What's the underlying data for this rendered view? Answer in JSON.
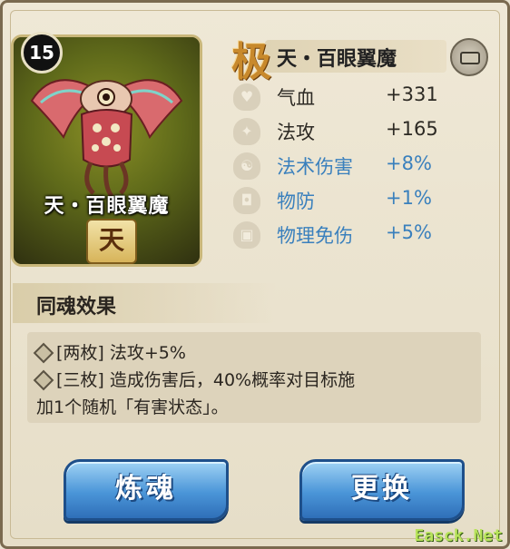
{
  "card": {
    "level": "15",
    "name": "天・百眼翼魔",
    "grade": "天"
  },
  "header": {
    "rank_char": "极",
    "title": "天・百眼翼魔",
    "lock_icon": "lock-icon"
  },
  "stats": [
    {
      "label": "气血",
      "value": "+331",
      "color": "#2d2a24",
      "icon": "heart-icon"
    },
    {
      "label": "法攻",
      "value": "+165",
      "color": "#2d2a24",
      "icon": "magic-attack-icon"
    },
    {
      "label": "法术伤害",
      "value": "+8%",
      "color": "#3a80bd",
      "icon": "yin-yang-icon"
    },
    {
      "label": "物防",
      "value": "+1%",
      "color": "#3a80bd",
      "icon": "shield-icon"
    },
    {
      "label": "物理免伤",
      "value": "+5%",
      "color": "#3a80bd",
      "icon": "shield-block-icon"
    }
  ],
  "effects": {
    "title": "同魂效果",
    "lines": [
      "[两枚] 法攻+5%",
      "[三枚] 造成伤害后，40%概率对目标施",
      "加1个随机「有害状态」。"
    ]
  },
  "buttons": {
    "refine": "炼魂",
    "replace": "更换"
  },
  "watermark": "Easck.Net"
}
